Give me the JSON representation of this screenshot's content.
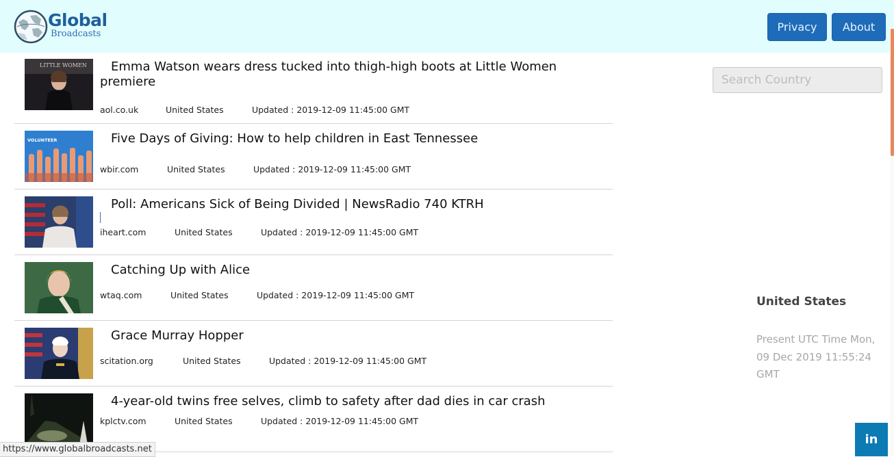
{
  "header": {
    "logo_title": "Global",
    "logo_subtitle": "Broadcasts",
    "privacy_label": "Privacy",
    "about_label": "About"
  },
  "articles": [
    {
      "title": "Emma Watson wears dress tucked into thigh-high boots at Little Women premiere",
      "source": "aol.co.uk",
      "country": "United States",
      "updated": "Updated : 2019-12-09 11:45:00 GMT",
      "thumb_text": "LITTLE WOMEN"
    },
    {
      "title": "Five Days of Giving: How to help children in East Tennessee",
      "source": "wbir.com",
      "country": "United States",
      "updated": "Updated : 2019-12-09 11:45:00 GMT",
      "thumb_text": "VOLUNTEER"
    },
    {
      "title": "Poll: Americans Sick of Being Divided | NewsRadio 740 KTRH",
      "source": "iheart.com",
      "country": "United States",
      "updated": "Updated : 2019-12-09 11:45:00 GMT",
      "thumb_text": ""
    },
    {
      "title": "Catching Up with Alice",
      "source": "wtaq.com",
      "country": "United States",
      "updated": "Updated : 2019-12-09 11:45:00 GMT",
      "thumb_text": ""
    },
    {
      "title": "Grace Murray Hopper",
      "source": "scitation.org",
      "country": "United States",
      "updated": "Updated : 2019-12-09 11:45:00 GMT",
      "thumb_text": ""
    },
    {
      "title": "4-year-old twins free selves, climb to safety after dad dies in car crash",
      "source": "kplctv.com",
      "country": "United States",
      "updated": "Updated : 2019-12-09 11:45:00 GMT",
      "thumb_text": ""
    }
  ],
  "sidebar": {
    "search_placeholder": "Search Country",
    "country": "United States",
    "utc_time": "Present UTC Time Mon, 09 Dec 2019 11:55:24 GMT"
  },
  "status_bar": {
    "url": "https://www.globalbroadcasts.net"
  },
  "social": {
    "linkedin_label": "in"
  },
  "colors": {
    "header_bg": "#e1fdfd",
    "button": "#1e6cb9",
    "linkedin": "#0c7bb3",
    "scroll_accent": "#e8875a"
  }
}
